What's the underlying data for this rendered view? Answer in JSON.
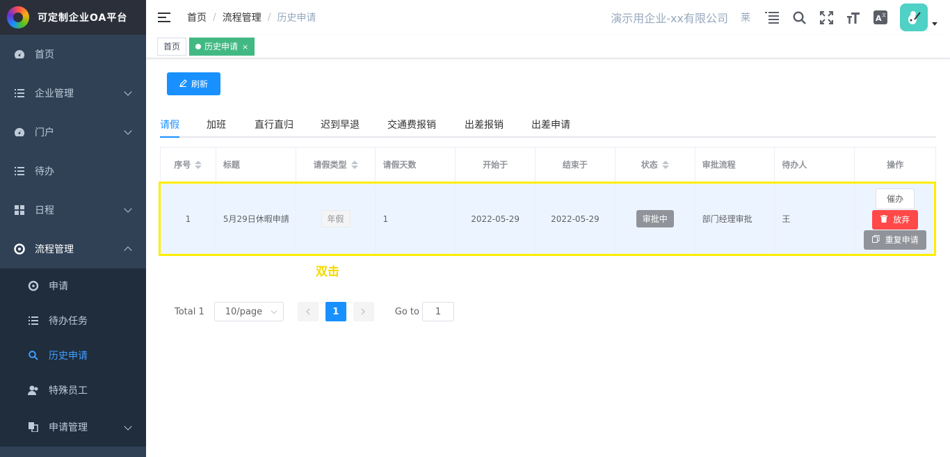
{
  "app": {
    "title": "可定制企业OA平台"
  },
  "sidebar": {
    "items": [
      {
        "label": "首页",
        "icon": "dashboard-icon"
      },
      {
        "label": "企业管理",
        "icon": "list-icon"
      },
      {
        "label": "门户",
        "icon": "dashboard-icon"
      },
      {
        "label": "待办",
        "icon": "list-icon"
      },
      {
        "label": "日程",
        "icon": "grid-icon"
      },
      {
        "label": "流程管理",
        "icon": "process-icon"
      }
    ],
    "sub_items": [
      {
        "label": "申请",
        "icon": "process-icon"
      },
      {
        "label": "待办任务",
        "icon": "list-icon"
      },
      {
        "label": "历史申请",
        "icon": "search-icon"
      },
      {
        "label": "特殊员工",
        "icon": "user-icon"
      },
      {
        "label": "申请管理",
        "icon": "copy-icon"
      }
    ]
  },
  "header": {
    "breadcrumb": [
      "首页",
      "流程管理",
      "历史申请"
    ],
    "company": "演示用企业-xx有限公司",
    "short": "莱"
  },
  "tags": {
    "home": "首页",
    "active": "历史申请",
    "close": "×"
  },
  "toolbar": {
    "refresh": "刷新"
  },
  "tabs": [
    "请假",
    "加班",
    "直行直归",
    "迟到早退",
    "交通费报销",
    "出差报销",
    "出差申请"
  ],
  "table": {
    "headers": [
      "序号",
      "标题",
      "请假类型",
      "请假天数",
      "开始于",
      "结束于",
      "状态",
      "审批流程",
      "待办人",
      "操作"
    ],
    "rows": [
      {
        "index": "1",
        "title": "5月29日休暇申請",
        "type": "年假",
        "days": "1",
        "start": "2022-05-29",
        "end": "2022-05-29",
        "status": "审批中",
        "flow": "部门经理审批",
        "assignee": "王",
        "ops": {
          "urge": "催办",
          "abandon": "放弃",
          "repeat": "重复申请"
        }
      }
    ]
  },
  "annotation": {
    "text": "双击",
    "color": "#ffed00"
  },
  "pagination": {
    "total": "Total 1",
    "page_size": "10/page",
    "current": "1",
    "goto_label": "Go to",
    "goto_value": "1"
  },
  "colors": {
    "sidebar_bg": "#304156",
    "primary": "#1890ff",
    "tag_active": "#42b983",
    "danger": "#ff4949",
    "info": "#909399"
  }
}
